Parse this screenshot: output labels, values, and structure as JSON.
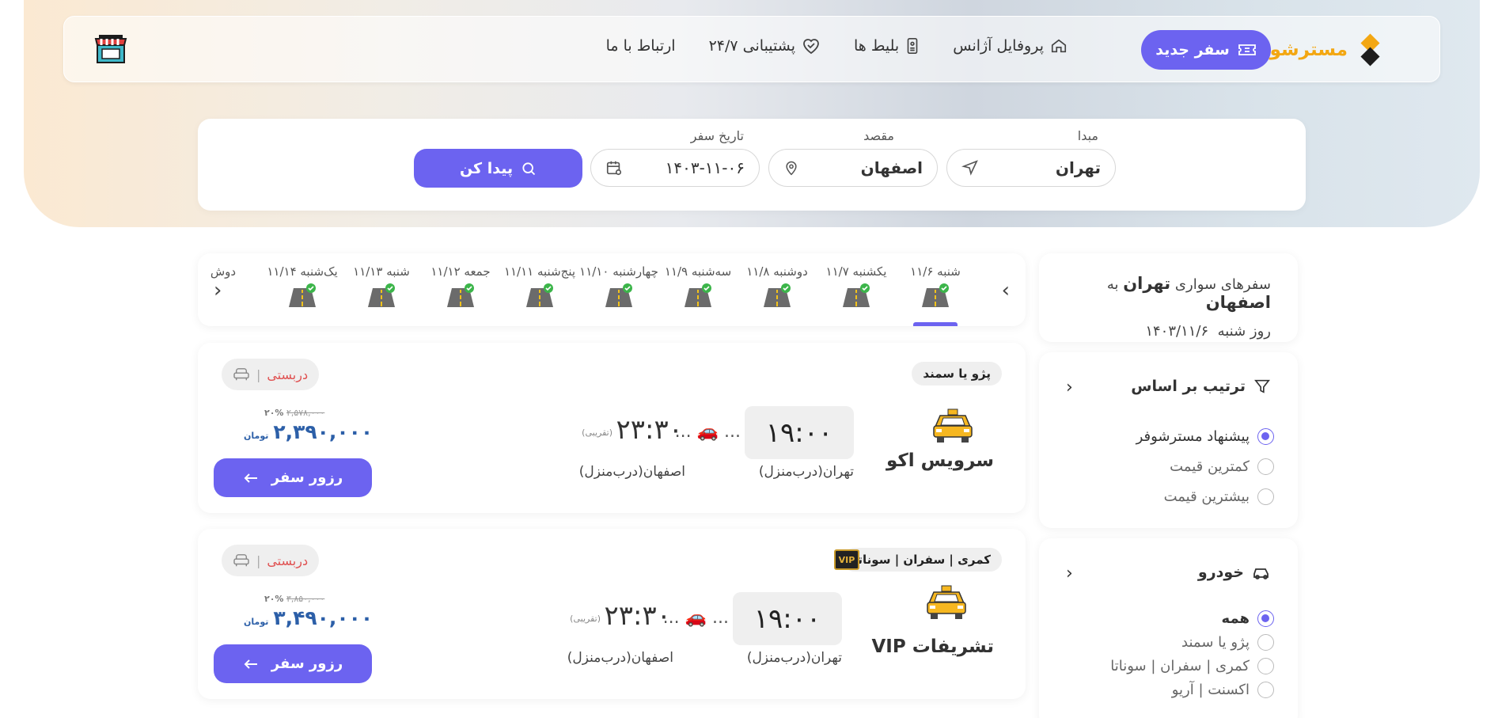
{
  "header": {
    "brand": "مسترشوفر",
    "new_trip": "سفر جدید",
    "nav": [
      {
        "label": "پروفایل آژانس",
        "icon": "home-icon"
      },
      {
        "label": "بلیط ها",
        "icon": "ticket-icon"
      },
      {
        "label": "پشتیبانی ۲۴/۷",
        "icon": "heart-handshake-icon"
      },
      {
        "label": "ارتباط با ما",
        "icon": ""
      }
    ]
  },
  "search": {
    "origin_label": "مبدا",
    "origin_value": "تهران",
    "destination_label": "مقصد",
    "destination_value": "اصفهان",
    "date_label": "تاریخ سفر",
    "date_value": "۱۴۰۳-۱۱-۰۶",
    "find_label": "پیدا کن"
  },
  "route_summary": {
    "prefix": "سفرهای سواری",
    "origin": "تهران",
    "to": "به",
    "destination": "اصفهان",
    "day_prefix": "روز شنبه",
    "date": "۱۴۰۳/۱۱/۶"
  },
  "sort": {
    "title": "ترتیب بر اساس",
    "options": [
      "پیشنهاد مسترشوفر",
      "کمترین قیمت",
      "بیشترین قیمت"
    ],
    "selected_index": 0
  },
  "vehicle_filter": {
    "title": "خودرو",
    "options": [
      "همه",
      "پژو یا سمند",
      "کمری | سفران | سوناتا",
      "اکسنت | آریو"
    ],
    "selected_index": 0
  },
  "dates": [
    {
      "label": "شنبه ۱۱/۶",
      "active": true
    },
    {
      "label": "یکشنبه ۱۱/۷",
      "active": false
    },
    {
      "label": "دوشنبه ۱۱/۸",
      "active": false
    },
    {
      "label": "سه‌شنبه ۱۱/۹",
      "active": false
    },
    {
      "label": "چهارشنبه ۱۱/۱۰",
      "active": false
    },
    {
      "label": "پنج‌شنبه ۱۱/۱۱",
      "active": false
    },
    {
      "label": "جمعه ۱۱/۱۲",
      "active": false
    },
    {
      "label": "شنبه ۱۱/۱۳",
      "active": false
    },
    {
      "label": "یک‌شنبه ۱۱/۱۴",
      "active": false
    },
    {
      "label": "دوش",
      "active": false
    }
  ],
  "trips": [
    {
      "vehicle": "پژو یا سمند",
      "vip": false,
      "name": "سرویس اکو",
      "departure": "۱۹:۰۰",
      "arrival": "۲۳:۳۰",
      "approx": "(تقریبی)",
      "dots": "... 🚗 ...",
      "origin_city": "تهران(درب‌منزل)",
      "dest_city": "اصفهان(درب‌منزل)",
      "seat": "دربستی",
      "old_price": "۲,۵۷۸,۰۰۰",
      "discount": "۲۰%",
      "price": "۲,۳۹۰,۰۰۰",
      "currency": "تومان",
      "reserve": "رزور سفر"
    },
    {
      "vehicle": "کمری | سفران | سوناتا",
      "vip": true,
      "vip_label": "VIP",
      "name": "تشریفات VIP",
      "departure": "۱۹:۰۰",
      "arrival": "۲۳:۳۰",
      "approx": "(تقریبی)",
      "dots": "... 🚗 ...",
      "origin_city": "تهران(درب‌منزل)",
      "dest_city": "اصفهان(درب‌منزل)",
      "seat": "دربستی",
      "old_price": "۳,۸۵۰,۰۰۰",
      "discount": "۲۰%",
      "price": "۳,۴۹۰,۰۰۰",
      "currency": "تومان",
      "reserve": "رزور سفر"
    }
  ],
  "colors": {
    "primary": "#6c63f0",
    "brand": "#f3a712",
    "price": "#2c5fa8",
    "seat": "#e05151"
  }
}
